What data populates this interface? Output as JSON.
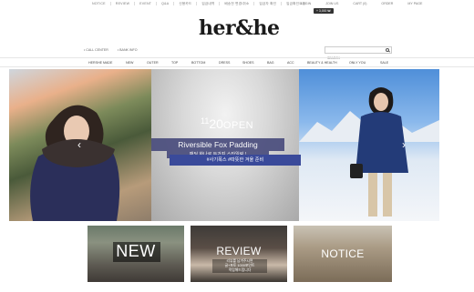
{
  "top_nav": [
    "NOTICE",
    "REVIEW",
    "EVENT",
    "Q&A",
    "신용카드",
    "입금내역",
    "배송전 변경/취소",
    "입금자 확인",
    "입금확인요청"
  ],
  "top_util": [
    "LOGIN",
    "JOIN US",
    "CART (0)",
    "ORDER",
    "MY PAGE"
  ],
  "cart_badge": "+ 3,000 ₩",
  "logo": "her&he",
  "sub_info": [
    "• CALL CENTER",
    "• BANK INFO"
  ],
  "search": {
    "placeholder": "SEARCH"
  },
  "categories": [
    "HERSHE MADE",
    "NEW",
    "OUTER",
    "TOP",
    "BOTTOM",
    "DRESS",
    "SHOES",
    "BAG",
    "ACC",
    "BEAUTY & HEALTH",
    "ONLY YOU",
    "SALE"
  ],
  "hero": {
    "date_month": "11",
    "date_day": "20",
    "date_open": "OPEN",
    "title": "Riversible Fox Padding",
    "subtitle": "패딩 하나로 두가지 스타일링 !",
    "tagline": "#사기폭스  #따뜻한 겨울 준비"
  },
  "thumbs": [
    {
      "label": "NEW"
    },
    {
      "label": "REVIEW",
      "caption": [
        "리뷰를 남겨주시면",
        "글+포토 1000포인트",
        "적립해드립니다"
      ]
    },
    {
      "label": "NOTICE"
    }
  ],
  "colors": {
    "banner_band": "#4a4d7d",
    "banner_tag": "#3a4a9a",
    "text": "#333333"
  }
}
